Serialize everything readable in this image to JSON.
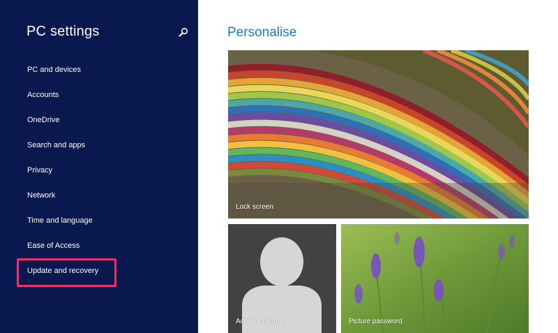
{
  "sidebar": {
    "title": "PC settings",
    "items": [
      {
        "label": "PC and devices"
      },
      {
        "label": "Accounts"
      },
      {
        "label": "OneDrive"
      },
      {
        "label": "Search and apps"
      },
      {
        "label": "Privacy"
      },
      {
        "label": "Network"
      },
      {
        "label": "Time and language"
      },
      {
        "label": "Ease of Access"
      },
      {
        "label": "Update and recovery"
      }
    ],
    "highlighted_item": "Update and recovery"
  },
  "main": {
    "title": "Personalise",
    "tiles": {
      "lock_screen": {
        "label": "Lock screen"
      },
      "account_picture": {
        "label": "Account picture"
      },
      "picture_password": {
        "label": "Picture password"
      }
    }
  },
  "colors": {
    "sidebar_bg": "#0a1850",
    "heading_blue": "#1e7ac4",
    "highlight_pink": "#ee2e6c"
  },
  "icons": {
    "search": "search-icon",
    "avatar": "person-silhouette-icon"
  }
}
